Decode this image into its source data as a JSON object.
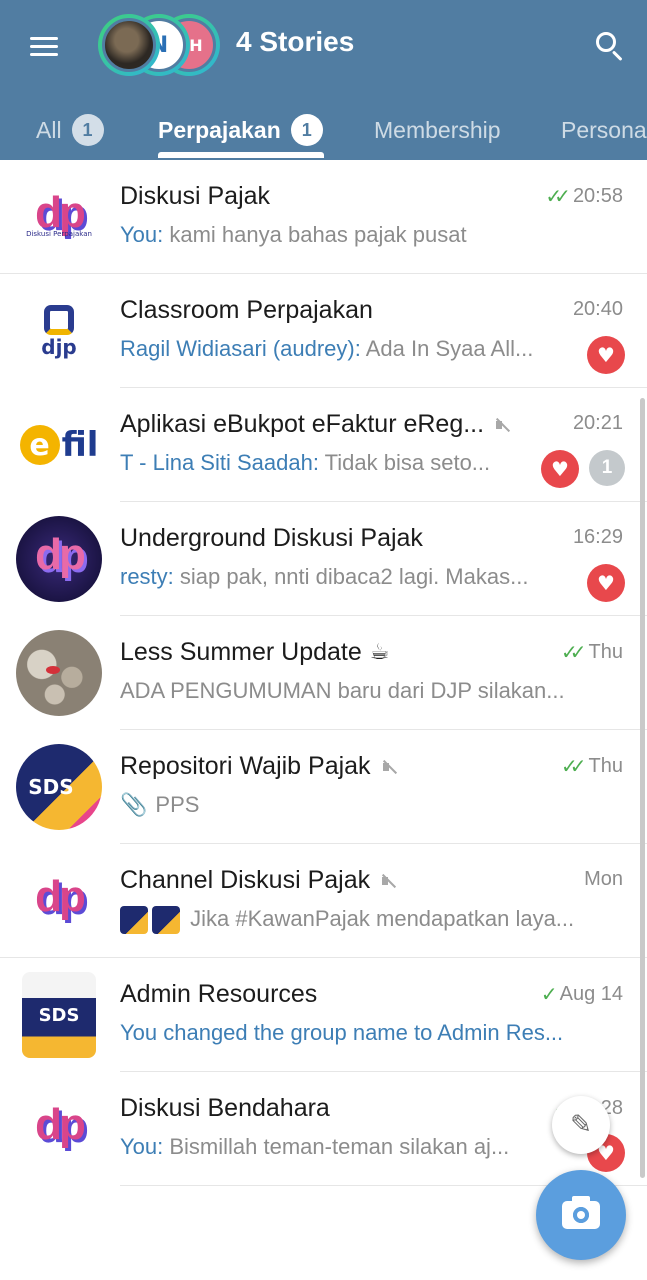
{
  "header": {
    "title": "4 Stories",
    "story_initials": [
      "",
      "N",
      "H"
    ]
  },
  "tabs": [
    {
      "label": "All",
      "count": "1"
    },
    {
      "label": "Perpajakan",
      "count": "1"
    },
    {
      "label": "Membership"
    },
    {
      "label": "Persona"
    }
  ],
  "chats": [
    {
      "name": "Diskusi Pajak",
      "time": "20:58",
      "read": "double",
      "sender": "You:",
      "message": " kami hanya bahas pajak pusat",
      "avatar_text": "dp",
      "avatar_sub": "Diskusi Perpajakan"
    },
    {
      "name": "Classroom Perpajakan",
      "time": "20:40",
      "sender": "Ragil Widiasari (audrey):",
      "message": " Ada In Syaa All...",
      "avatar_text": "djp",
      "reaction": "heart"
    },
    {
      "name": "Aplikasi eBukpot eFaktur eReg...",
      "time": "20:21",
      "muted": true,
      "sender": "T - Lina Siti Saadah:",
      "message": " Tidak bisa seto...",
      "avatar_text": "fil",
      "avatar_letter": "e",
      "reaction": "heart",
      "unread": "1"
    },
    {
      "name": "Underground Diskusi Pajak",
      "time": "16:29",
      "sender": "resty:",
      "message": " siap pak, nnti dibaca2 lagi. Makas...",
      "avatar_text": "dp",
      "reaction": "heart"
    },
    {
      "name": "Less Summer Update",
      "emoji": "☕",
      "time": "Thu",
      "read": "double",
      "message": "ADA PENGUMUMAN baru dari DJP  silakan..."
    },
    {
      "name": "Repositori Wajib Pajak",
      "time": "Thu",
      "read": "double",
      "muted": true,
      "message": "PPS",
      "attachment": true,
      "avatar_text": "SDS"
    },
    {
      "name": "Channel Diskusi Pajak",
      "time": "Mon",
      "muted": true,
      "message": "Jika #KawanPajak mendapatkan laya...",
      "avatar_text": "dp"
    },
    {
      "name": "Admin Resources",
      "time": "Aug 14",
      "read": "single",
      "message": "You changed the group name to Admin Res...",
      "avatar_text": "SDS"
    },
    {
      "name": "Diskusi Bendahara",
      "time": "…28",
      "read": "double",
      "sender": "You:",
      "message": " Bismillah teman-teman silakan aj...",
      "avatar_text": "dp",
      "reaction": "heart"
    }
  ],
  "icons": {
    "menu": "hamburger-icon",
    "search": "search-icon",
    "edit": "pencil-icon",
    "camera": "camera-icon"
  },
  "colors": {
    "header": "#517da2",
    "accent_blue": "#3d7eb5",
    "check_green": "#4dae50",
    "heart_red": "#e8484c",
    "fab_blue": "#5b9ede"
  }
}
